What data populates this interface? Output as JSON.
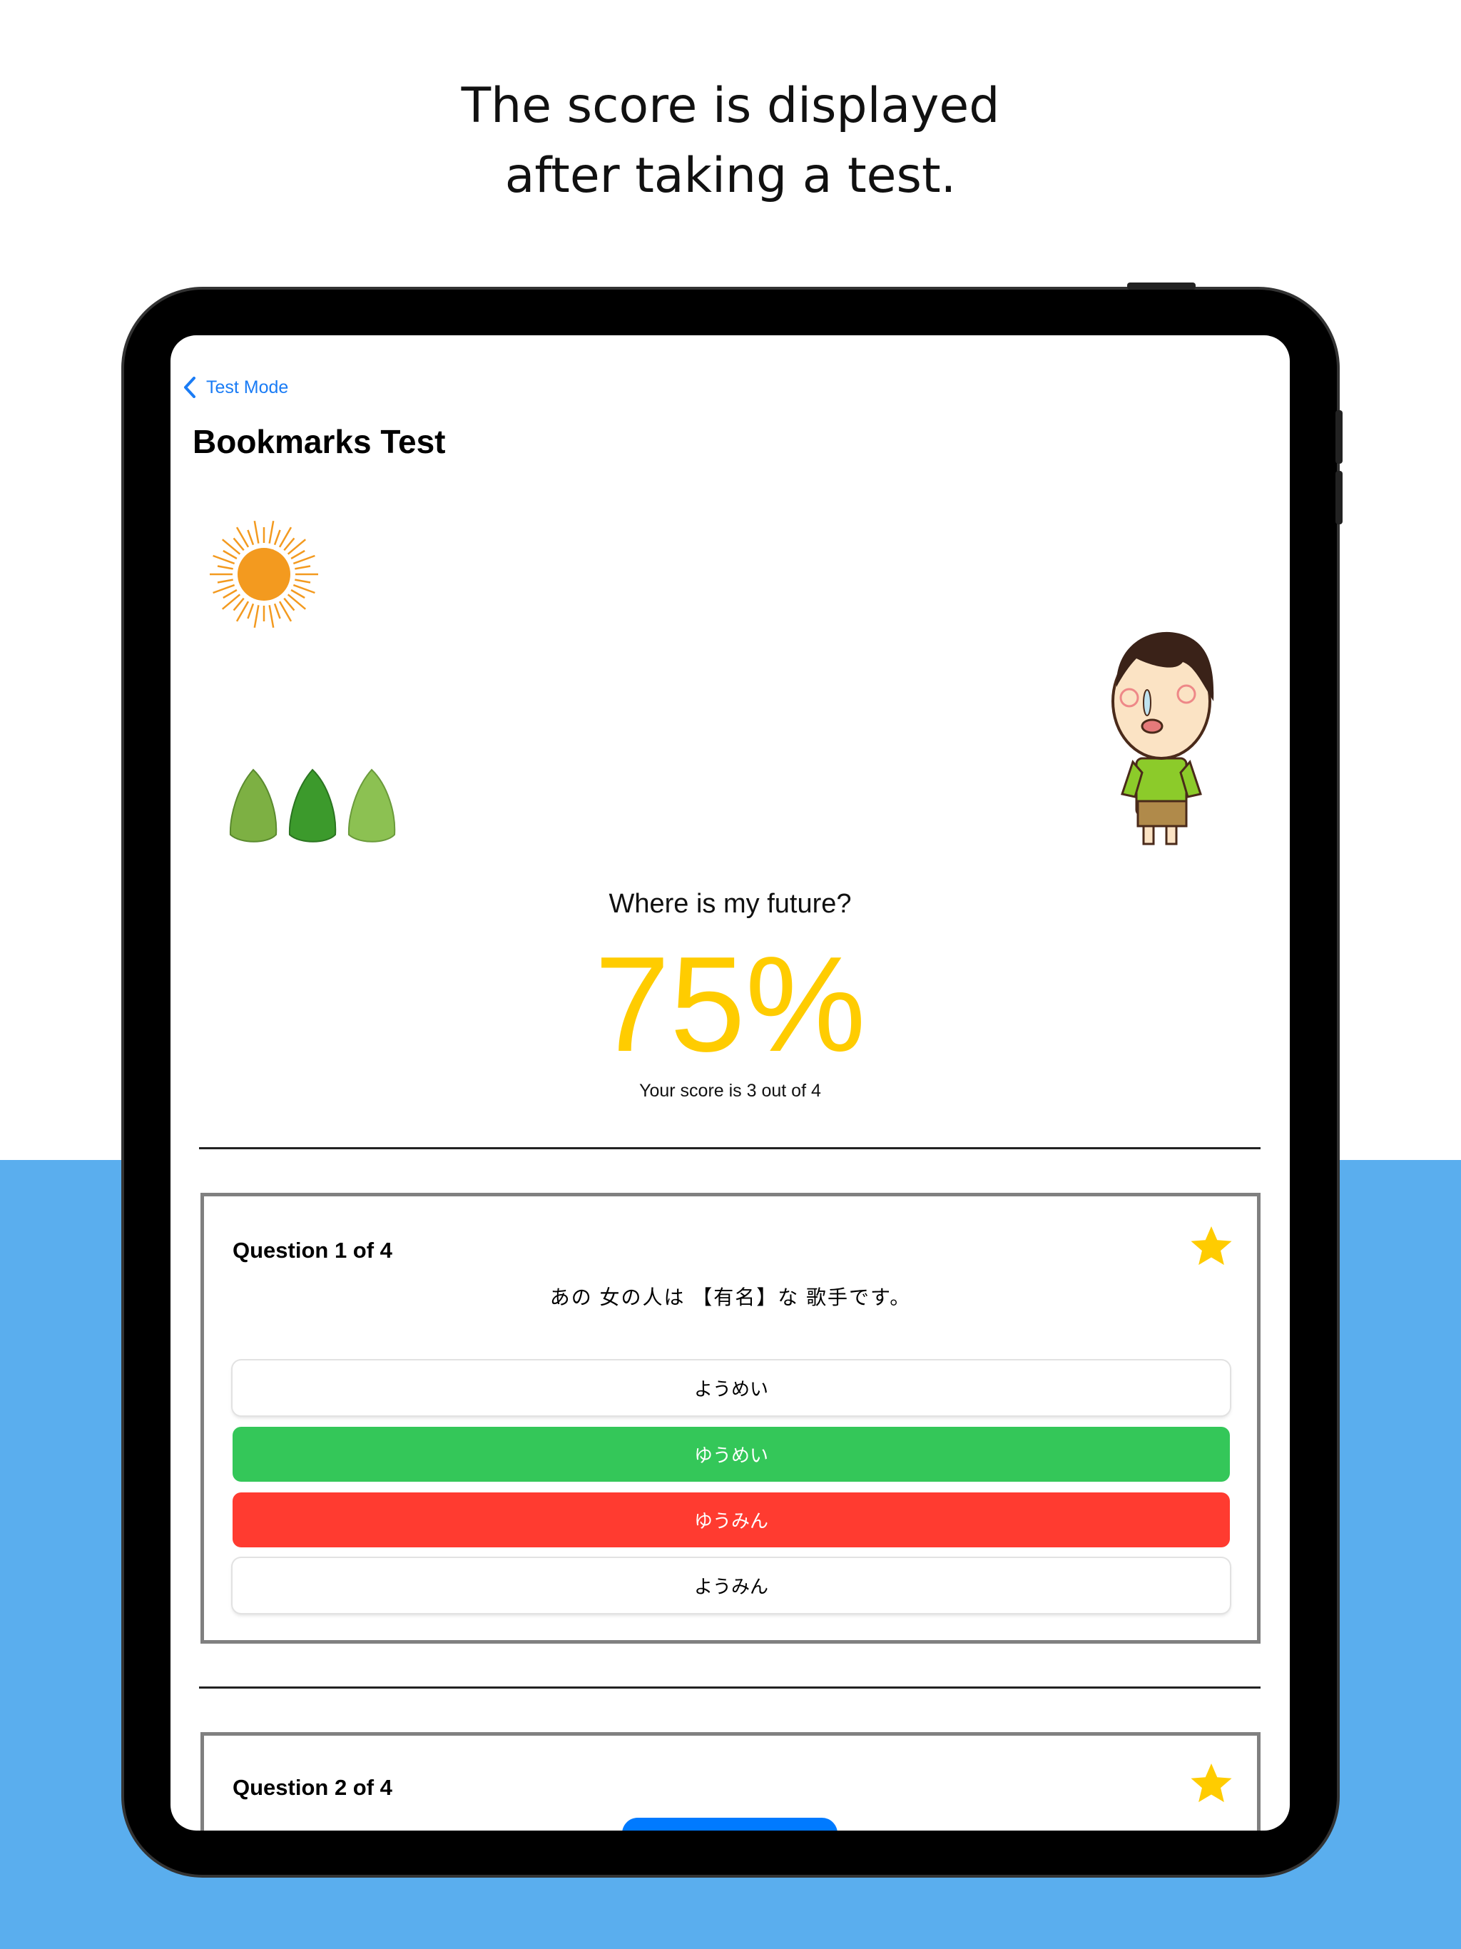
{
  "caption": "The score is displayed\n after taking a test.",
  "nav": {
    "back_label": "Test Mode",
    "title": "Bookmarks Test"
  },
  "result": {
    "message": "Where is my future?",
    "percent": "75%",
    "score_text": "Your score is 3 out of 4"
  },
  "questions": [
    {
      "label": "Question 1 of 4",
      "sentence": "あの 女の人は 【有名】な 歌手です。",
      "bookmarked": true,
      "options": [
        {
          "text": "ようめい",
          "state": "neutral"
        },
        {
          "text": "ゆうめい",
          "state": "correct"
        },
        {
          "text": "ゆうみん",
          "state": "wrong"
        },
        {
          "text": "ようみん",
          "state": "neutral"
        }
      ]
    },
    {
      "label": "Question 2 of 4",
      "bookmarked": true
    }
  ],
  "colors": {
    "accent": "#1A7CF5",
    "score": "#FFCC00",
    "correct": "#34C759",
    "wrong": "#FF3B30",
    "background": "#5AAEEE"
  }
}
